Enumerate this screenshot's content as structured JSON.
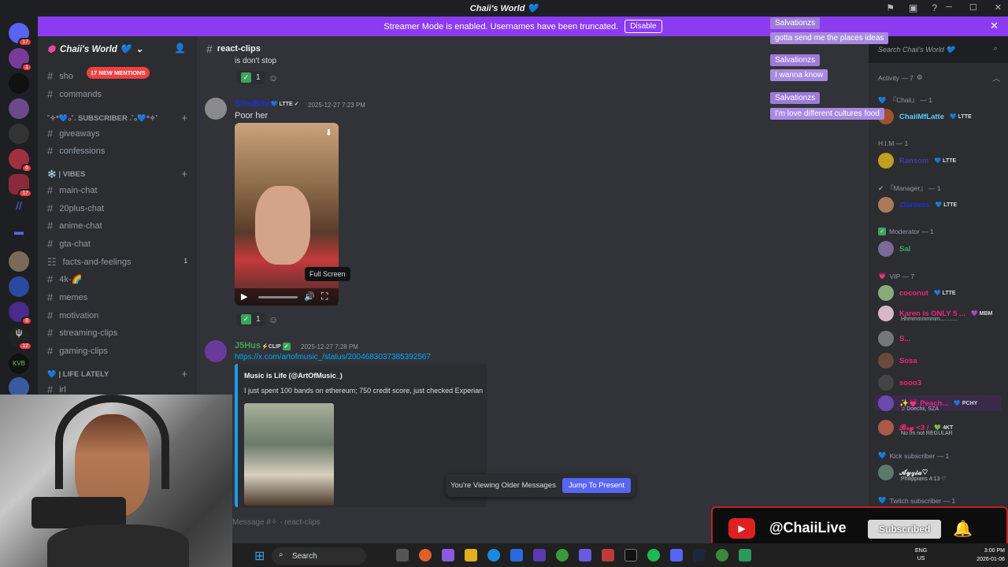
{
  "window": {
    "title": "Chaii's World 💙",
    "min": "─",
    "max": "☐",
    "close": "✕"
  },
  "banner": {
    "text": "Streamer Mode is enabled. Usernames have been truncated.",
    "button": "Disable",
    "close": "✕"
  },
  "servers": {
    "badges": [
      "17",
      "1",
      "6",
      "17",
      "12",
      "8",
      "12"
    ]
  },
  "sidebar": {
    "server_name": "Chaii's World 💙",
    "new_mentions": "17 NEW MENTIONS",
    "channels_top": [
      {
        "label": "sho"
      },
      {
        "label": "commands"
      }
    ],
    "cat_subscriber": "˚✧*💙ₒ˚. SUBSCRIBER .˚ₒ💙*✧˚",
    "channels_sub": [
      {
        "label": "giveaways"
      },
      {
        "label": "confessions"
      }
    ],
    "cat_vibes": "❄️ | VIBES",
    "channels_vibes": [
      {
        "label": "main-chat"
      },
      {
        "label": "20plus-chat"
      },
      {
        "label": "anime-chat"
      },
      {
        "label": "gta-chat"
      },
      {
        "label": "facts-and-feelings",
        "count": "1"
      },
      {
        "label": "4k-🌈"
      },
      {
        "label": "memes"
      },
      {
        "label": "motivation"
      },
      {
        "label": "streaming-clips"
      },
      {
        "label": "gaming-clips"
      }
    ],
    "cat_life": "💙 | LIFE LATELY",
    "channels_life": [
      {
        "label": "irl"
      }
    ]
  },
  "channel": {
    "name": "react-clips"
  },
  "messages": {
    "prev_text": "is don't stop",
    "reaction_count": "1",
    "m1": {
      "user": "SlimBites",
      "tag": "LTTE",
      "time": "2025-12-27 7:23 PM",
      "text": "Poor her",
      "tooltip": "Full Screen"
    },
    "m2": {
      "user": "J5Hus",
      "tag": "CLIP",
      "time": "2025-12-27 7:28 PM",
      "link": "https://x.com/artofmusic_/status/2004683037385392567",
      "embed_author": "Music is Life (@ArtOfMusic_)",
      "embed_text": "I just spent 100 bands on ethereum; 750 credit score, just checked Experian"
    }
  },
  "jump": {
    "text": "You're Viewing Older Messages",
    "button": "Jump To Present"
  },
  "composer": {
    "placeholder": "Message #✧ · react-clips"
  },
  "search": {
    "placeholder": "Search Chaii's World 💙"
  },
  "overlay_chat": [
    {
      "user": "Salvationzs",
      "msg": "gotta send me the places ideas"
    },
    {
      "user": "Salvationzs",
      "msg": "I wanna know"
    },
    {
      "user": "Salvationzs",
      "msg": "I'm love different cultures food"
    }
  ],
  "members": {
    "activity": "Activity — 7",
    "groups": [
      {
        "head": "『Chaii』 — 1",
        "name": "ChaiiMfLatte",
        "tag": "LTTE",
        "color": "#5ecbf5"
      },
      {
        "head": "H.I.M — 1",
        "name": "Ransom",
        "tag": "LTTE",
        "color": "#4a3aa0"
      },
      {
        "head": "『Manager』 — 1",
        "name": "Zluniess",
        "tag": "LTTE",
        "color": "#2030d0"
      },
      {
        "head": "Moderator — 1",
        "name": "Sal",
        "tag": "",
        "color": "#3ba55c"
      },
      {
        "head": "VIP — 7",
        "name": "",
        "tag": "",
        "color": ""
      }
    ],
    "vip": [
      {
        "name": "coconut",
        "tag": "LTTE",
        "sub": "",
        "color": "#f0247c"
      },
      {
        "name": "Karen is ONLY 5 ...",
        "tag": "MBM",
        "sub": "Hhmmmmmmm...........",
        "color": "#f0247c"
      },
      {
        "name": "S...",
        "tag": "",
        "sub": "",
        "color": "#f0247c"
      },
      {
        "name": "Sosa",
        "tag": "",
        "sub": "",
        "color": "#f0247c"
      },
      {
        "name": "sooo3",
        "tag": "",
        "sub": "",
        "color": "#f0247c"
      },
      {
        "name": "✨💗 Peach...",
        "tag": "PCHY",
        "sub": "♫ Doechii, SZA",
        "color": "#f0247c"
      },
      {
        "name": "𝓑𝓻𝔂 <3 /",
        "tag": "4KT",
        "sub": "No im not REGULAR",
        "color": "#f0247c"
      }
    ],
    "kick": {
      "head": "Kick subscriber — 1",
      "name": "𝓐𝔂𝔃𝓲𝓪♡",
      "sub": "Philippians 4:13 ♡"
    },
    "twitch": {
      "head": "Twitch subscriber — 1"
    }
  },
  "youtube": {
    "handle": "@ChaiiLive",
    "button": "Subscribed"
  },
  "taskbar": {
    "search": "Search",
    "lang": "ENG\nUS",
    "time": "3:00 PM",
    "date": "2026-01-06"
  }
}
